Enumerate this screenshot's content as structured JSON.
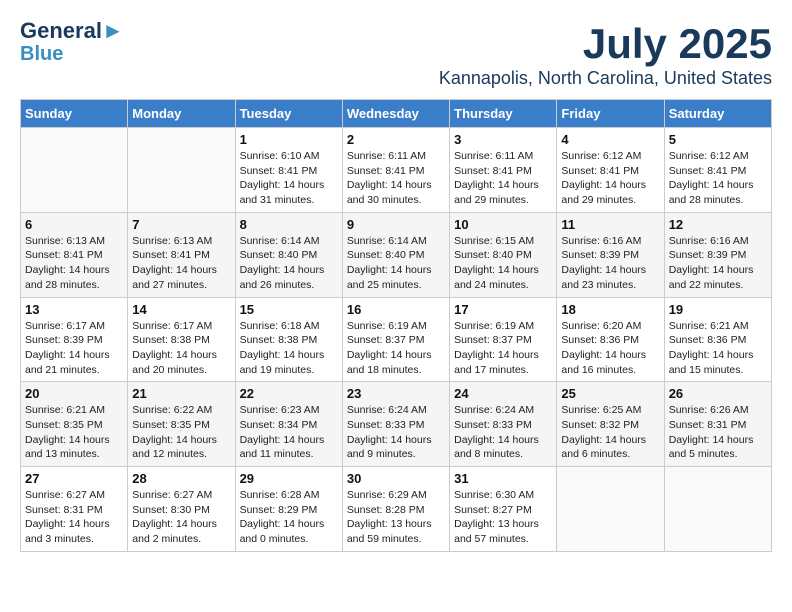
{
  "logo": {
    "line1": "General",
    "line2": "Blue"
  },
  "title": "July 2025",
  "subtitle": "Kannapolis, North Carolina, United States",
  "days_of_week": [
    "Sunday",
    "Monday",
    "Tuesday",
    "Wednesday",
    "Thursday",
    "Friday",
    "Saturday"
  ],
  "weeks": [
    [
      {
        "day": "",
        "detail": ""
      },
      {
        "day": "",
        "detail": ""
      },
      {
        "day": "1",
        "detail": "Sunrise: 6:10 AM\nSunset: 8:41 PM\nDaylight: 14 hours\nand 31 minutes."
      },
      {
        "day": "2",
        "detail": "Sunrise: 6:11 AM\nSunset: 8:41 PM\nDaylight: 14 hours\nand 30 minutes."
      },
      {
        "day": "3",
        "detail": "Sunrise: 6:11 AM\nSunset: 8:41 PM\nDaylight: 14 hours\nand 29 minutes."
      },
      {
        "day": "4",
        "detail": "Sunrise: 6:12 AM\nSunset: 8:41 PM\nDaylight: 14 hours\nand 29 minutes."
      },
      {
        "day": "5",
        "detail": "Sunrise: 6:12 AM\nSunset: 8:41 PM\nDaylight: 14 hours\nand 28 minutes."
      }
    ],
    [
      {
        "day": "6",
        "detail": "Sunrise: 6:13 AM\nSunset: 8:41 PM\nDaylight: 14 hours\nand 28 minutes."
      },
      {
        "day": "7",
        "detail": "Sunrise: 6:13 AM\nSunset: 8:41 PM\nDaylight: 14 hours\nand 27 minutes."
      },
      {
        "day": "8",
        "detail": "Sunrise: 6:14 AM\nSunset: 8:40 PM\nDaylight: 14 hours\nand 26 minutes."
      },
      {
        "day": "9",
        "detail": "Sunrise: 6:14 AM\nSunset: 8:40 PM\nDaylight: 14 hours\nand 25 minutes."
      },
      {
        "day": "10",
        "detail": "Sunrise: 6:15 AM\nSunset: 8:40 PM\nDaylight: 14 hours\nand 24 minutes."
      },
      {
        "day": "11",
        "detail": "Sunrise: 6:16 AM\nSunset: 8:39 PM\nDaylight: 14 hours\nand 23 minutes."
      },
      {
        "day": "12",
        "detail": "Sunrise: 6:16 AM\nSunset: 8:39 PM\nDaylight: 14 hours\nand 22 minutes."
      }
    ],
    [
      {
        "day": "13",
        "detail": "Sunrise: 6:17 AM\nSunset: 8:39 PM\nDaylight: 14 hours\nand 21 minutes."
      },
      {
        "day": "14",
        "detail": "Sunrise: 6:17 AM\nSunset: 8:38 PM\nDaylight: 14 hours\nand 20 minutes."
      },
      {
        "day": "15",
        "detail": "Sunrise: 6:18 AM\nSunset: 8:38 PM\nDaylight: 14 hours\nand 19 minutes."
      },
      {
        "day": "16",
        "detail": "Sunrise: 6:19 AM\nSunset: 8:37 PM\nDaylight: 14 hours\nand 18 minutes."
      },
      {
        "day": "17",
        "detail": "Sunrise: 6:19 AM\nSunset: 8:37 PM\nDaylight: 14 hours\nand 17 minutes."
      },
      {
        "day": "18",
        "detail": "Sunrise: 6:20 AM\nSunset: 8:36 PM\nDaylight: 14 hours\nand 16 minutes."
      },
      {
        "day": "19",
        "detail": "Sunrise: 6:21 AM\nSunset: 8:36 PM\nDaylight: 14 hours\nand 15 minutes."
      }
    ],
    [
      {
        "day": "20",
        "detail": "Sunrise: 6:21 AM\nSunset: 8:35 PM\nDaylight: 14 hours\nand 13 minutes."
      },
      {
        "day": "21",
        "detail": "Sunrise: 6:22 AM\nSunset: 8:35 PM\nDaylight: 14 hours\nand 12 minutes."
      },
      {
        "day": "22",
        "detail": "Sunrise: 6:23 AM\nSunset: 8:34 PM\nDaylight: 14 hours\nand 11 minutes."
      },
      {
        "day": "23",
        "detail": "Sunrise: 6:24 AM\nSunset: 8:33 PM\nDaylight: 14 hours\nand 9 minutes."
      },
      {
        "day": "24",
        "detail": "Sunrise: 6:24 AM\nSunset: 8:33 PM\nDaylight: 14 hours\nand 8 minutes."
      },
      {
        "day": "25",
        "detail": "Sunrise: 6:25 AM\nSunset: 8:32 PM\nDaylight: 14 hours\nand 6 minutes."
      },
      {
        "day": "26",
        "detail": "Sunrise: 6:26 AM\nSunset: 8:31 PM\nDaylight: 14 hours\nand 5 minutes."
      }
    ],
    [
      {
        "day": "27",
        "detail": "Sunrise: 6:27 AM\nSunset: 8:31 PM\nDaylight: 14 hours\nand 3 minutes."
      },
      {
        "day": "28",
        "detail": "Sunrise: 6:27 AM\nSunset: 8:30 PM\nDaylight: 14 hours\nand 2 minutes."
      },
      {
        "day": "29",
        "detail": "Sunrise: 6:28 AM\nSunset: 8:29 PM\nDaylight: 14 hours\nand 0 minutes."
      },
      {
        "day": "30",
        "detail": "Sunrise: 6:29 AM\nSunset: 8:28 PM\nDaylight: 13 hours\nand 59 minutes."
      },
      {
        "day": "31",
        "detail": "Sunrise: 6:30 AM\nSunset: 8:27 PM\nDaylight: 13 hours\nand 57 minutes."
      },
      {
        "day": "",
        "detail": ""
      },
      {
        "day": "",
        "detail": ""
      }
    ]
  ]
}
